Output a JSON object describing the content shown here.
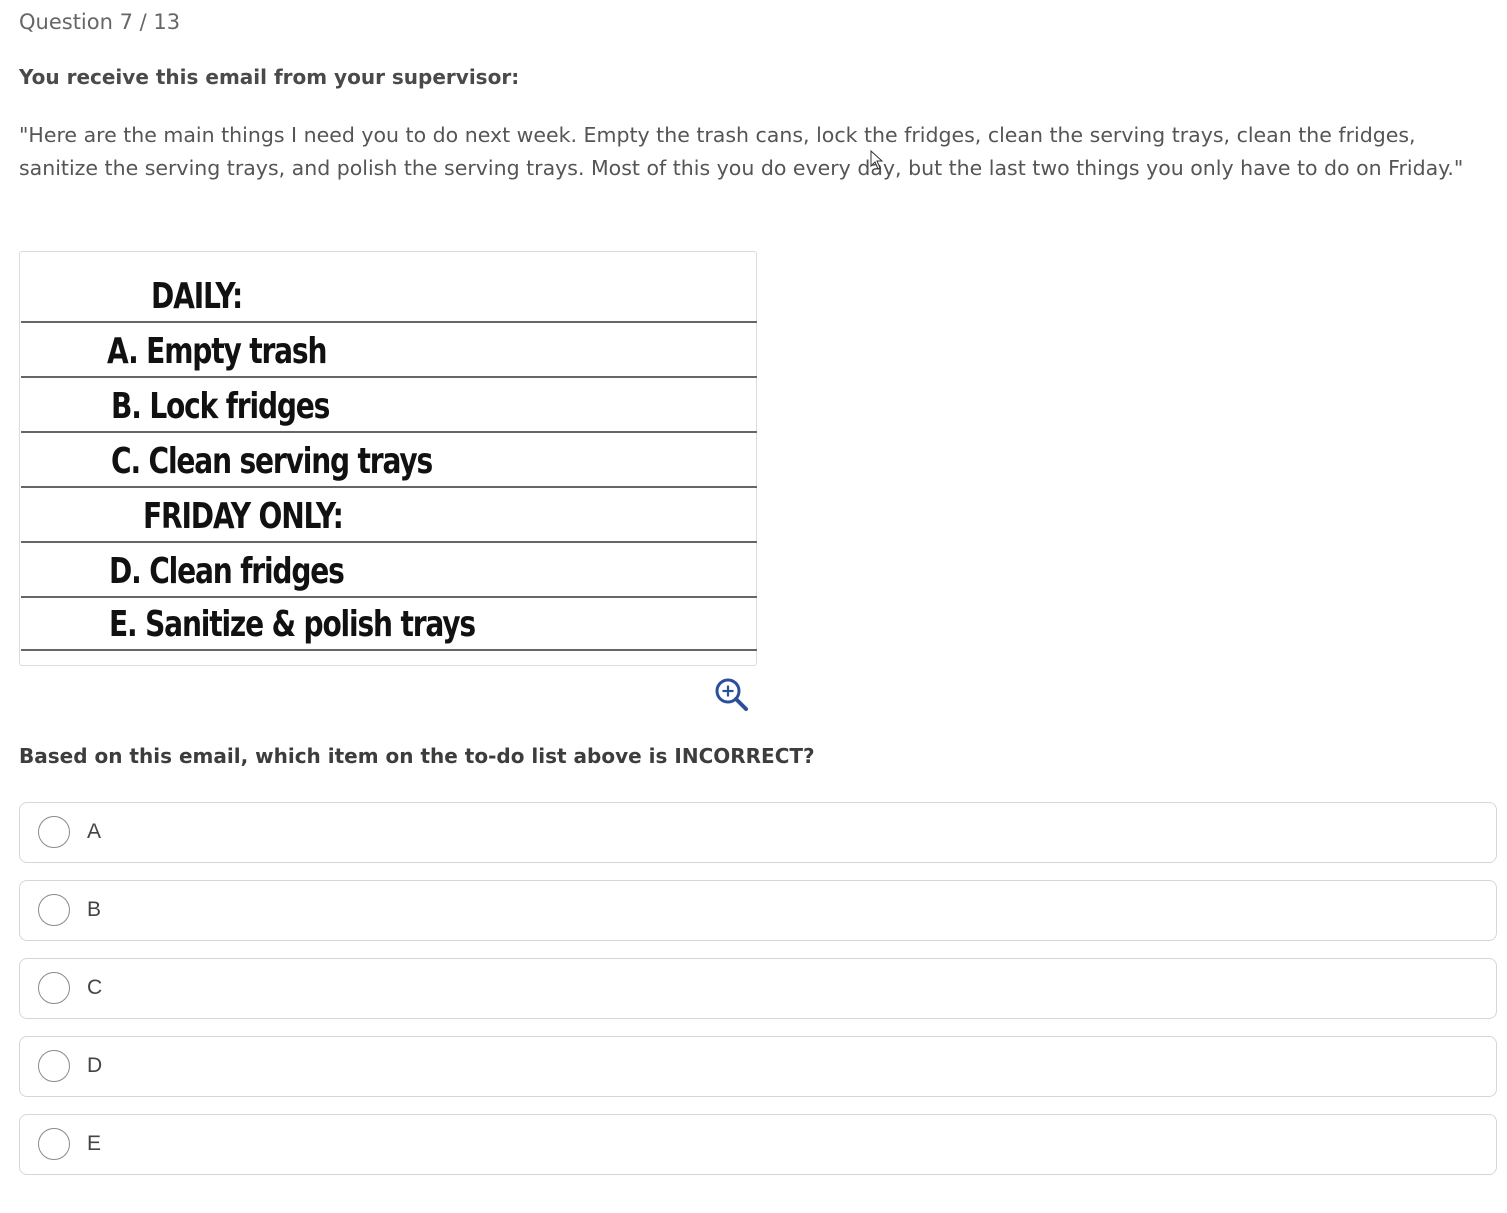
{
  "header": {
    "progress": "Question 7 / 13"
  },
  "prompt": {
    "intro": "You receive this email from your supervisor:",
    "email_text": "\"Here are the main things I need you to do next week. Empty the trash cans, lock the fridges, clean the serving trays, clean the fridges, sanitize the serving trays, and polish the serving trays. Most of this you do every day, but the last two things you only have to do on Friday.\""
  },
  "todo_list": {
    "rows": [
      {
        "text": "DAILY:",
        "kind": "heading"
      },
      {
        "text": "A. Empty trash",
        "kind": "item"
      },
      {
        "text": "B. Lock fridges",
        "kind": "item"
      },
      {
        "text": "C. Clean serving trays",
        "kind": "item"
      },
      {
        "text": "FRIDAY ONLY:",
        "kind": "heading"
      },
      {
        "text": "D. Clean fridges",
        "kind": "item"
      },
      {
        "text": "E. Sanitize & polish trays",
        "kind": "item"
      }
    ],
    "zoom_icon": "zoom-in-icon"
  },
  "question": {
    "text": "Based on this email, which item on the to-do list above is INCORRECT?",
    "options": [
      {
        "label": "A",
        "selected": false
      },
      {
        "label": "B",
        "selected": false
      },
      {
        "label": "C",
        "selected": false
      },
      {
        "label": "D",
        "selected": false
      },
      {
        "label": "E",
        "selected": false
      }
    ]
  },
  "colors": {
    "accent_icon": "#2b4f9a",
    "option_border": "#d6d6d6",
    "text": "#555555"
  }
}
